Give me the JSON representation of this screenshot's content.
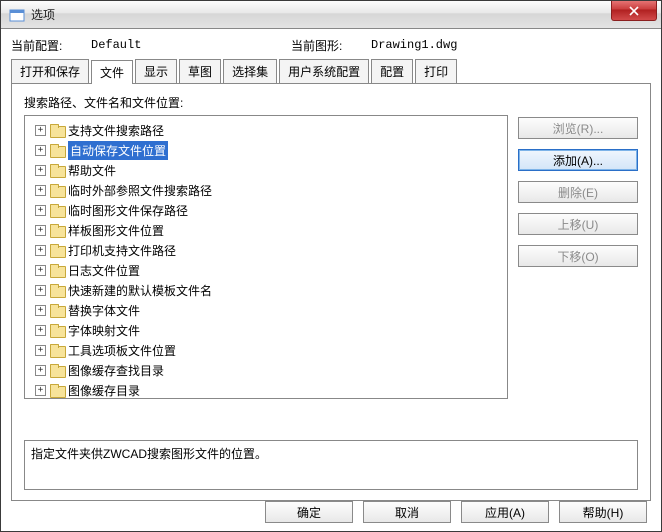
{
  "window": {
    "title": "选项"
  },
  "config": {
    "current_config_label": "当前配置:",
    "current_config_value": "Default",
    "current_drawing_label": "当前图形:",
    "current_drawing_value": "Drawing1.dwg"
  },
  "tabs": [
    {
      "label": "打开和保存"
    },
    {
      "label": "文件"
    },
    {
      "label": "显示"
    },
    {
      "label": "草图"
    },
    {
      "label": "选择集"
    },
    {
      "label": "用户系统配置"
    },
    {
      "label": "配置"
    },
    {
      "label": "打印"
    }
  ],
  "section_label": "搜索路径、文件名和文件位置:",
  "tree": [
    {
      "label": "支持文件搜索路径"
    },
    {
      "label": "自动保存文件位置",
      "selected": true
    },
    {
      "label": "帮助文件"
    },
    {
      "label": "临时外部参照文件搜索路径"
    },
    {
      "label": "临时图形文件保存路径"
    },
    {
      "label": "样板图形文件位置"
    },
    {
      "label": "打印机支持文件路径"
    },
    {
      "label": "日志文件位置"
    },
    {
      "label": "快速新建的默认模板文件名"
    },
    {
      "label": "替换字体文件"
    },
    {
      "label": "字体映射文件"
    },
    {
      "label": "工具选项板文件位置"
    },
    {
      "label": "图像缓存查找目录"
    },
    {
      "label": "图像缓存目录"
    }
  ],
  "side_buttons": {
    "browse": "浏览(R)...",
    "add": "添加(A)...",
    "delete": "删除(E)",
    "moveup": "上移(U)",
    "movedown": "下移(O)"
  },
  "description": "指定文件夹供ZWCAD搜索图形文件的位置。",
  "bottom_buttons": {
    "ok": "确定",
    "cancel": "取消",
    "apply": "应用(A)",
    "help": "帮助(H)"
  }
}
